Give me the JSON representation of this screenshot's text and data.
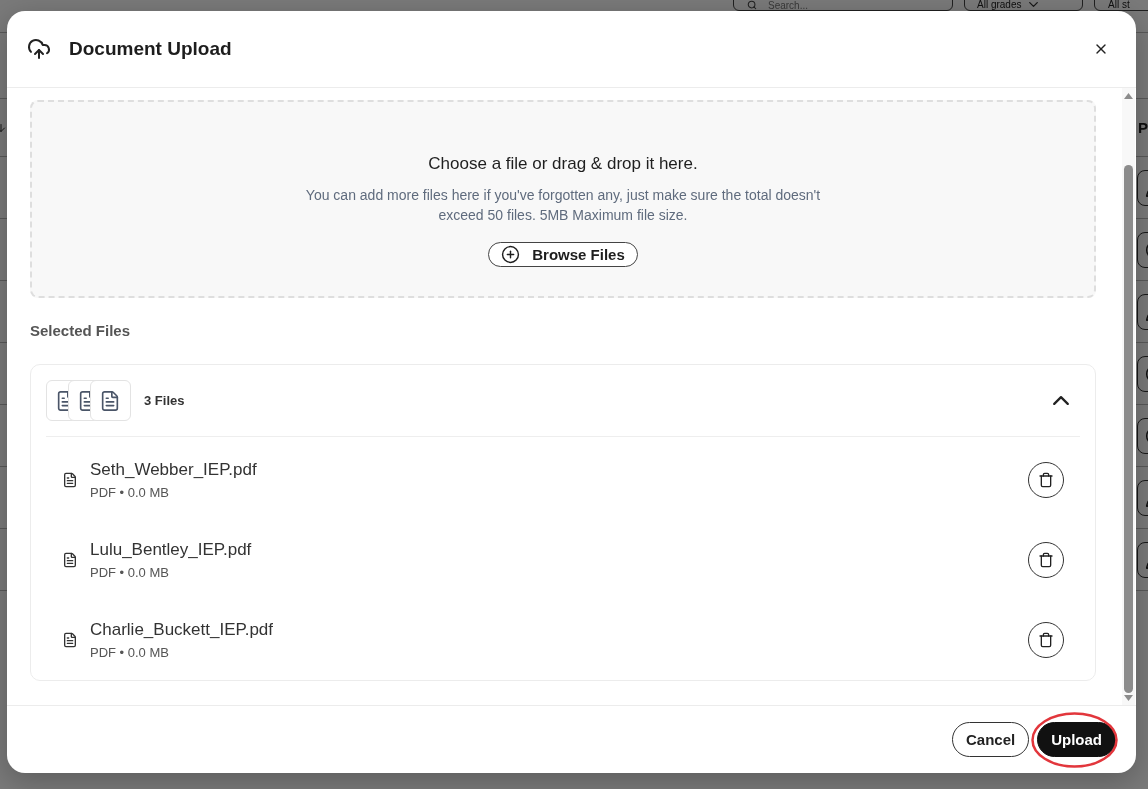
{
  "background_page": {
    "filters": {
      "search": {
        "placeholder": "Search..."
      },
      "grade_select": {
        "value": "All grades"
      },
      "student_select": {
        "value": "All st"
      }
    },
    "table": {
      "last_column_header": "P",
      "rows": [
        {
          "kind": "edit"
        },
        {
          "kind": "add"
        },
        {
          "kind": "edit"
        },
        {
          "kind": "add"
        },
        {
          "kind": "add"
        },
        {
          "kind": "edit"
        },
        {
          "kind": "edit"
        }
      ]
    }
  },
  "dialog": {
    "title": "Document Upload",
    "dropzone": {
      "heading": "Choose a file or drag & drop it here.",
      "description": "You can add more files here if you've forgotten any, just make sure the total doesn't exceed 50 files. 5MB Maximum file size.",
      "browse_button": "Browse Files"
    },
    "selected_files": {
      "label": "Selected Files",
      "summary": "3 Files",
      "expanded": true,
      "files": [
        {
          "name": "Seth_Webber_IEP.pdf",
          "meta": "PDF • 0.0 MB"
        },
        {
          "name": "Lulu_Bentley_IEP.pdf",
          "meta": "PDF • 0.0 MB"
        },
        {
          "name": "Charlie_Buckett_IEP.pdf",
          "meta": "PDF • 0.0 MB"
        }
      ]
    },
    "buttons": [
      {
        "label": "Cancel",
        "kind": "secondary",
        "circled": false
      },
      {
        "label": "Upload",
        "kind": "primary",
        "circled": true
      }
    ]
  }
}
